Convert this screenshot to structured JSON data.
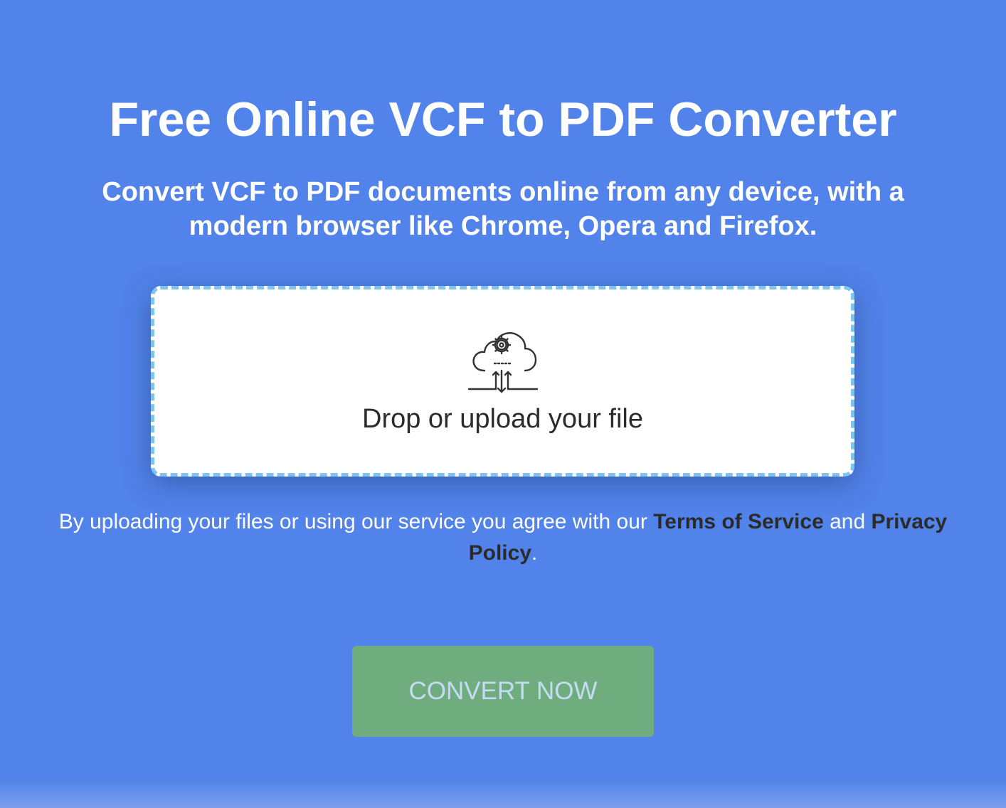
{
  "header": {
    "title": "Free Online VCF to PDF Converter",
    "subtitle": "Convert VCF to PDF documents online from any device, with a modern browser like Chrome, Opera and Firefox."
  },
  "dropzone": {
    "icon": "cloud-upload-gear-icon",
    "label": "Drop or upload your file"
  },
  "agreement": {
    "prefix": "By uploading your files or using our service you agree with our ",
    "terms_link": "Terms of Service",
    "middle": " and ",
    "privacy_link": "Privacy Policy",
    "suffix": "."
  },
  "actions": {
    "convert_label": "CONVERT NOW"
  },
  "colors": {
    "background": "#5283ea",
    "dropzone_border": "#7ec4ef",
    "button_bg": "#6fad7f",
    "button_text": "#c5dbf4"
  }
}
